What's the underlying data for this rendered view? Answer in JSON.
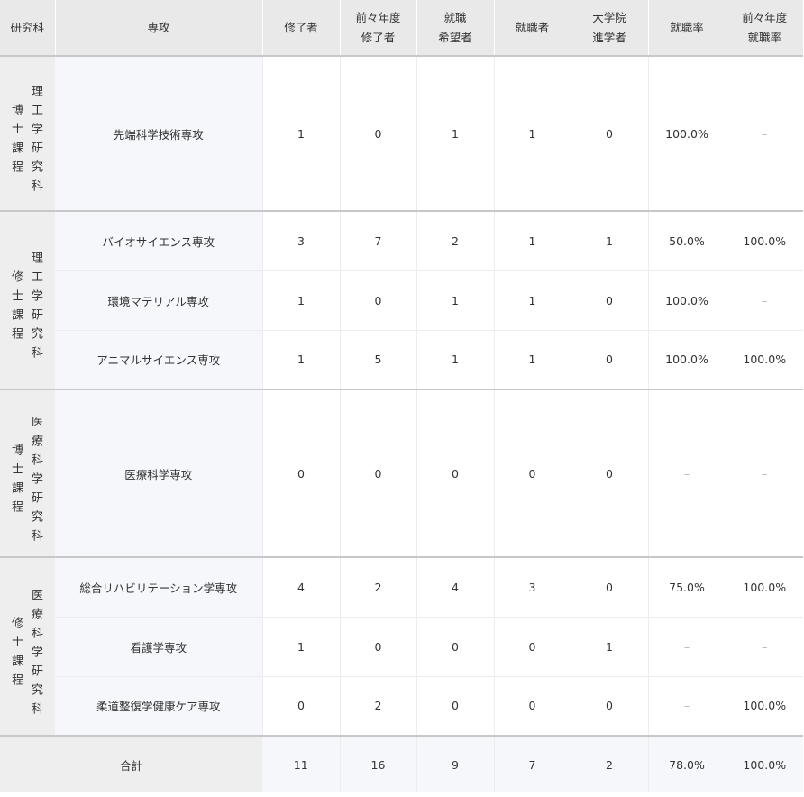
{
  "header": {
    "graduate_school": "研究科",
    "major": "専攻",
    "completed": "修了者",
    "prev_completed": [
      "前々年度",
      "修了者"
    ],
    "job_seekers": [
      "就職",
      "希望者"
    ],
    "employed": "就職者",
    "grad_school_entry": [
      "大学院",
      "進学者"
    ],
    "employment_rate": "就職率",
    "prev_employment_rate": [
      "前々年度",
      "就職率"
    ]
  },
  "groups": [
    {
      "school": [
        "理工学研究科",
        "博士課程"
      ],
      "rows": [
        {
          "major": "先端科学技術専攻",
          "completed": "1",
          "prev_completed": "0",
          "job_seekers": "1",
          "employed": "1",
          "grad_school_entry": "0",
          "employment_rate": "100.0%",
          "prev_employment_rate": "–"
        }
      ]
    },
    {
      "school": [
        "理工学研究科",
        "修士課程"
      ],
      "rows": [
        {
          "major": "バイオサイエンス専攻",
          "completed": "3",
          "prev_completed": "7",
          "job_seekers": "2",
          "employed": "1",
          "grad_school_entry": "1",
          "employment_rate": "50.0%",
          "prev_employment_rate": "100.0%"
        },
        {
          "major": "環境マテリアル専攻",
          "completed": "1",
          "prev_completed": "0",
          "job_seekers": "1",
          "employed": "1",
          "grad_school_entry": "0",
          "employment_rate": "100.0%",
          "prev_employment_rate": "–"
        },
        {
          "major": "アニマルサイエンス専攻",
          "completed": "1",
          "prev_completed": "5",
          "job_seekers": "1",
          "employed": "1",
          "grad_school_entry": "0",
          "employment_rate": "100.0%",
          "prev_employment_rate": "100.0%"
        }
      ]
    },
    {
      "school": [
        "医療科学研究科",
        "博士課程"
      ],
      "rows": [
        {
          "major": "医療科学専攻",
          "completed": "0",
          "prev_completed": "0",
          "job_seekers": "0",
          "employed": "0",
          "grad_school_entry": "0",
          "employment_rate": "–",
          "prev_employment_rate": "–"
        }
      ]
    },
    {
      "school": [
        "医療科学研究科",
        "修士課程"
      ],
      "rows": [
        {
          "major": "総合リハビリテーション学専攻",
          "completed": "4",
          "prev_completed": "2",
          "job_seekers": "4",
          "employed": "3",
          "grad_school_entry": "0",
          "employment_rate": "75.0%",
          "prev_employment_rate": "100.0%"
        },
        {
          "major": "看護学専攻",
          "completed": "1",
          "prev_completed": "0",
          "job_seekers": "0",
          "employed": "0",
          "grad_school_entry": "1",
          "employment_rate": "–",
          "prev_employment_rate": "–"
        },
        {
          "major": "柔道整復学健康ケア専攻",
          "completed": "0",
          "prev_completed": "2",
          "job_seekers": "0",
          "employed": "0",
          "grad_school_entry": "0",
          "employment_rate": "–",
          "prev_employment_rate": "100.0%"
        }
      ]
    }
  ],
  "total": {
    "label": "合計",
    "completed": "11",
    "prev_completed": "16",
    "job_seekers": "9",
    "employed": "7",
    "grad_school_entry": "2",
    "employment_rate": "78.0%",
    "prev_employment_rate": "100.0%"
  }
}
